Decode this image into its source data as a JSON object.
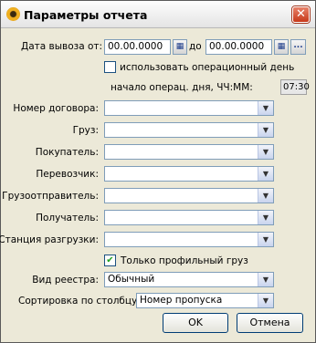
{
  "window": {
    "title": "Параметры отчета",
    "close_glyph": "✕"
  },
  "date": {
    "from_label": "Дата вывоза от:",
    "from_value": "00.00.0000",
    "to_label": "до",
    "to_value": "00.00.0000",
    "more_label": "..."
  },
  "opday": {
    "checkbox_label": "использовать операционный день",
    "checked": false,
    "start_label": "начало операц. дня, ЧЧ:ММ:",
    "start_value": "07:30"
  },
  "filters": [
    {
      "label": "Номер договора:",
      "value": ""
    },
    {
      "label": "Груз:",
      "value": ""
    },
    {
      "label": "Покупатель:",
      "value": ""
    },
    {
      "label": "Перевозчик:",
      "value": ""
    },
    {
      "label": "Грузоотправитель:",
      "value": ""
    },
    {
      "label": "Получатель:",
      "value": ""
    },
    {
      "label": "Станция разгрузки:",
      "value": ""
    }
  ],
  "profile": {
    "label": "Только профильный груз",
    "checked": true,
    "check_glyph": "✔"
  },
  "registry": {
    "label": "Вид реестра:",
    "value": "Обычный"
  },
  "sort": {
    "label": "Сортировка по столбцу:",
    "value": "Номер пропуска"
  },
  "buttons": {
    "ok": "OK",
    "cancel": "Отмена"
  },
  "icons": {
    "dropdown": "chevron-down-icon",
    "calendar": "calendar-icon"
  }
}
